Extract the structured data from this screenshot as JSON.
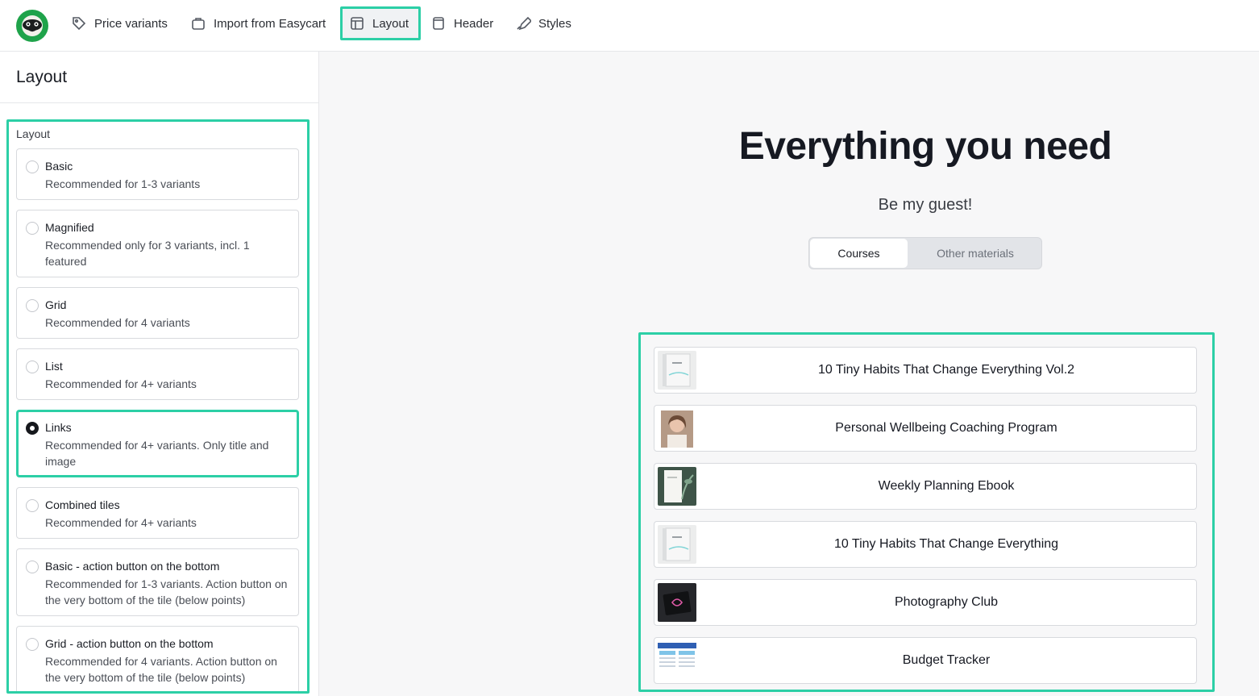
{
  "nav": {
    "items": [
      {
        "label": "Price variants",
        "icon": "tag-icon"
      },
      {
        "label": "Import from Easycart",
        "icon": "cart-icon"
      },
      {
        "label": "Layout",
        "icon": "layout-icon",
        "active": true
      },
      {
        "label": "Header",
        "icon": "header-icon"
      },
      {
        "label": "Styles",
        "icon": "brush-icon"
      }
    ]
  },
  "sidebar": {
    "title": "Layout",
    "group_label": "Layout",
    "options": [
      {
        "title": "Basic",
        "desc": "Recommended for 1-3 variants",
        "selected": false
      },
      {
        "title": "Magnified",
        "desc": "Recommended only for 3 variants, incl. 1 featured",
        "selected": false
      },
      {
        "title": "Grid",
        "desc": "Recommended for 4 variants",
        "selected": false
      },
      {
        "title": "List",
        "desc": "Recommended for 4+ variants",
        "selected": false
      },
      {
        "title": "Links",
        "desc": "Recommended for 4+ variants. Only title and image",
        "selected": true
      },
      {
        "title": "Combined tiles",
        "desc": "Recommended for 4+ variants",
        "selected": false
      },
      {
        "title": "Basic - action button on the bottom",
        "desc": "Recommended for 1-3 variants. Action button on the very bottom of the tile (below points)",
        "selected": false
      },
      {
        "title": "Grid - action button on the bottom",
        "desc": "Recommended for 4 variants. Action button on the very bottom of the tile (below points)",
        "selected": false
      }
    ]
  },
  "preview": {
    "title": "Everything you need",
    "subtitle": "Be my guest!",
    "tabs": [
      {
        "label": "Courses",
        "active": true
      },
      {
        "label": "Other materials",
        "active": false
      }
    ],
    "links": [
      {
        "title": "10 Tiny Habits That Change Everything Vol.2",
        "thumb": "book-thumb"
      },
      {
        "title": "Personal Wellbeing Coaching Program",
        "thumb": "portrait-thumb"
      },
      {
        "title": "Weekly Planning Ebook",
        "thumb": "plant-thumb"
      },
      {
        "title": "10 Tiny Habits That Change Everything",
        "thumb": "book-thumb"
      },
      {
        "title": "Photography Club",
        "thumb": "dark-thumb"
      },
      {
        "title": "Budget Tracker",
        "thumb": "spreadsheet-thumb"
      }
    ]
  },
  "colors": {
    "accent": "#2ccfa6",
    "logo": "#1fa34a"
  }
}
